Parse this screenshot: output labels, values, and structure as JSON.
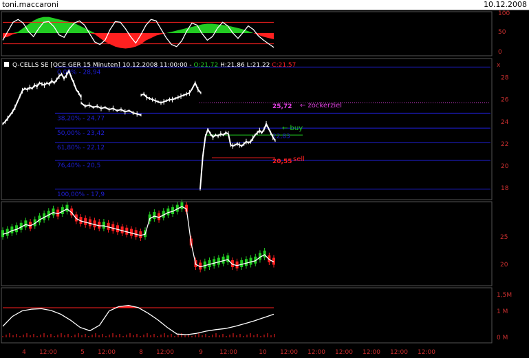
{
  "header": {
    "user": "toni.maccaroni",
    "date": "10.12.2008"
  },
  "quote": {
    "name": "Q-CELLS SE [QCE GER  15 Minuten] 10.12.2008 11:00:00 - ",
    "open": "O:21,72",
    "high": "H:21,86",
    "low": "L:21,22",
    "close": "C:21,57"
  },
  "colors": {
    "fib": "#1f1fd8",
    "target": "#e040e0",
    "buy": "#22cc22",
    "sell": "#ff2020",
    "up": "#22cc22",
    "down": "#ff2020",
    "line": "#ffffff",
    "axis": "#cc3030"
  },
  "chart_data": [
    {
      "type": "area",
      "name": "oscillator",
      "y_ticks": [
        "0",
        "50",
        "100"
      ],
      "levels": [
        20,
        80
      ],
      "values": [
        30,
        55,
        80,
        88,
        78,
        55,
        40,
        62,
        80,
        82,
        68,
        45,
        38,
        62,
        78,
        84,
        72,
        48,
        25,
        18,
        30,
        60,
        82,
        80,
        62,
        40,
        22,
        45,
        72,
        88,
        84,
        60,
        36,
        18,
        12,
        28,
        56,
        78,
        72,
        48,
        30,
        40,
        64,
        80,
        70,
        50,
        35,
        52,
        70,
        60,
        42,
        30,
        20,
        10
      ],
      "fill_values": [
        -8,
        -6,
        -2,
        2,
        8,
        14,
        20,
        24,
        26,
        26,
        24,
        22,
        20,
        18,
        16,
        12,
        8,
        4,
        -2,
        -8,
        -14,
        -18,
        -22,
        -24,
        -25,
        -24,
        -22,
        -18,
        -12,
        -8,
        -4,
        -2,
        0,
        2,
        4,
        6,
        8,
        10,
        12,
        14,
        15,
        15,
        14,
        13,
        12,
        10,
        8,
        6,
        3,
        0,
        -3,
        -6,
        -8,
        -10
      ]
    },
    {
      "type": "line",
      "name": "price",
      "y_ticks": [
        "18",
        "20",
        "22",
        "24",
        "26",
        "28"
      ],
      "ylim": [
        17.2,
        29.4
      ],
      "fib_levels": [
        {
          "label": "0,00% - 28,94",
          "price": 28.94
        },
        {
          "label": "38,20% - 24,77",
          "price": 24.77
        },
        {
          "label": "50,00% - 23,42",
          "price": 23.42
        },
        {
          "label": "61,80% - 22,12",
          "price": 22.12
        },
        {
          "label": "76,40% - 20,5",
          "price": 20.5
        },
        {
          "label": "100,00% - 17,9",
          "price": 17.9
        }
      ],
      "target": {
        "value": "25,72",
        "price": 25.72,
        "note": "← zockerziel"
      },
      "buy": {
        "note": "← buy",
        "price": 23.42
      },
      "buy_value": {
        "value": "22,83",
        "price": 22.83
      },
      "sell": {
        "value": "20,55",
        "note": "sell",
        "price": 20.55
      },
      "segments": [
        [
          23.8,
          24.0,
          24.3,
          24.6,
          24.9,
          25.3,
          25.8,
          26.3,
          26.8,
          27.0,
          26.9,
          27.1,
          27.0,
          27.3,
          27.2,
          27.5,
          27.4,
          27.3,
          27.5,
          27.4,
          27.7,
          27.5,
          27.8,
          28.1,
          28.3,
          27.9,
          28.2,
          28.6,
          28.0,
          27.5,
          26.9,
          26.6,
          26.2
        ],
        [
          25.7,
          25.4,
          25.5,
          25.3,
          25.4,
          25.2,
          25.3,
          25.1,
          25.2,
          25.0,
          25.1,
          24.9,
          25.0,
          24.8,
          24.7,
          24.6
        ],
        [
          26.4,
          26.5,
          26.2,
          26.1,
          26.0,
          25.9,
          25.8,
          25.7,
          25.8,
          25.9,
          26.0,
          26.0,
          26.1,
          26.2,
          26.3,
          26.4,
          26.5,
          26.6,
          27.0,
          27.5,
          26.9,
          26.6
        ],
        [
          17.9,
          20.8,
          22.6,
          23.3,
          22.9,
          22.6,
          22.8,
          22.7,
          22.9,
          22.8,
          23.0,
          22.9
        ],
        [
          22.9,
          21.9,
          21.8,
          21.9,
          22.0,
          21.9,
          21.8,
          22.0,
          22.2,
          22.1,
          22.2,
          22.5,
          22.8,
          23.0,
          23.2,
          23.0,
          23.3,
          23.8,
          23.4,
          23.0,
          22.6,
          22.3
        ]
      ]
    },
    {
      "type": "line",
      "name": "price-overview",
      "y_ticks": [
        "25",
        "20"
      ],
      "values": [
        37,
        38,
        40,
        41,
        43,
        45,
        44,
        46,
        49,
        51,
        53,
        55,
        54,
        56,
        58,
        55,
        50,
        48,
        47,
        46,
        45,
        44,
        44,
        43,
        42,
        41,
        40,
        39,
        38,
        37,
        36,
        37,
        50,
        52,
        51,
        53,
        55,
        56,
        58,
        60,
        58,
        30,
        12,
        10,
        11,
        12,
        13,
        14,
        15,
        16,
        12,
        11,
        12,
        13,
        14,
        15,
        18,
        20,
        16,
        14
      ]
    },
    {
      "type": "area",
      "name": "volume-indicator",
      "y_ticks": [
        "1,5M",
        "1 M",
        "0 M"
      ],
      "values": [
        0.5,
        0.95,
        1.2,
        1.28,
        1.3,
        1.22,
        1.05,
        0.78,
        0.45,
        0.3,
        0.55,
        1.2,
        1.4,
        1.45,
        1.35,
        1.1,
        0.8,
        0.45,
        0.15,
        0.12,
        0.18,
        0.28,
        0.35,
        0.4,
        0.5,
        0.62,
        0.75,
        0.9,
        1.05
      ],
      "x_ticks": [
        "4",
        "12:00",
        "5",
        "12:00",
        "8",
        "12:00",
        "9",
        "12:00",
        "10",
        "12:00",
        "12:00",
        "12:00",
        "12:00",
        "12:00",
        "12:00"
      ]
    }
  ]
}
